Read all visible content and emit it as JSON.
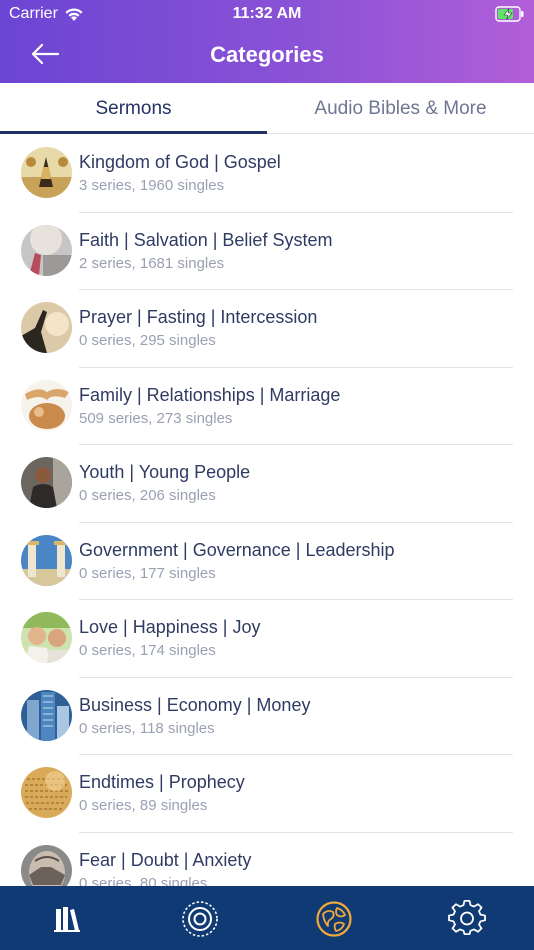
{
  "status": {
    "carrier": "Carrier",
    "time": "11:32 AM"
  },
  "nav": {
    "title": "Categories"
  },
  "tabs": [
    {
      "label": "Sermons",
      "active": true
    },
    {
      "label": "Audio Bibles & More",
      "active": false
    }
  ],
  "categories": [
    {
      "title": "Kingdom of God | Gospel",
      "subtitle": "3 series, 1960 singles"
    },
    {
      "title": "Faith | Salvation | Belief System",
      "subtitle": "2 series, 1681 singles"
    },
    {
      "title": "Prayer | Fasting | Intercession",
      "subtitle": "0 series, 295 singles"
    },
    {
      "title": "Family | Relationships | Marriage",
      "subtitle": "509 series, 273 singles"
    },
    {
      "title": "Youth | Young People",
      "subtitle": "0 series, 206 singles"
    },
    {
      "title": "Government | Governance | Leadership",
      "subtitle": "0 series, 177 singles"
    },
    {
      "title": "Love | Happiness | Joy",
      "subtitle": "0 series, 174 singles"
    },
    {
      "title": "Business | Economy | Money",
      "subtitle": "0 series, 118 singles"
    },
    {
      "title": "Endtimes | Prophecy",
      "subtitle": "0 series, 89 singles"
    },
    {
      "title": "Fear | Doubt | Anxiety",
      "subtitle": "0 series, 80 singles"
    }
  ],
  "tabbar": [
    {
      "icon": "library-icon",
      "active": false
    },
    {
      "icon": "radio-icon",
      "active": false
    },
    {
      "icon": "categories-icon",
      "active": true
    },
    {
      "icon": "settings-icon",
      "active": false
    }
  ],
  "colors": {
    "header_start": "#6b45d3",
    "header_end": "#b15fd8",
    "tabbar_bg": "#0f3a73",
    "active_tab_icon": "#f2a93b",
    "title_text": "#2f3b63",
    "subtitle_text": "#9aa0b2"
  }
}
